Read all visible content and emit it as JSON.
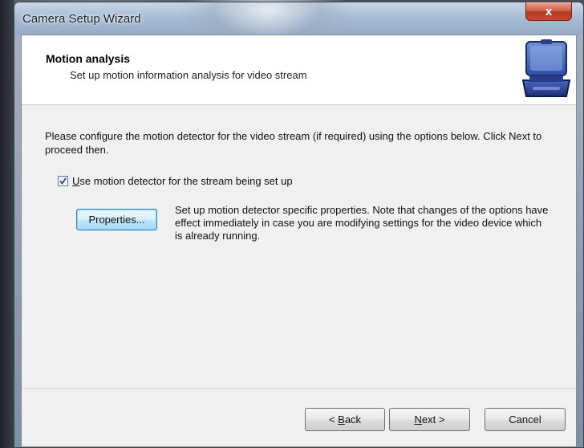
{
  "window": {
    "title": "Camera Setup Wizard",
    "close_label": "x"
  },
  "header": {
    "title": "Motion analysis",
    "subtitle": "Set up motion information analysis for video stream",
    "icon": "camera-case-icon"
  },
  "body": {
    "instructions": "Please configure the motion detector for the video stream (if required) using the options below. Click Next to proceed then.",
    "use_motion_detector": {
      "checked": true,
      "label_mnemonic": "U",
      "label_rest": "se motion detector for the stream being set up"
    },
    "properties_button": "Properties...",
    "properties_description": "Set up motion detector specific properties. Note that changes of the options have effect immediately in case you are modifying settings for the video device which is already running."
  },
  "footer": {
    "back_prefix": "< ",
    "back_mnemonic": "B",
    "back_rest": "ack",
    "next_mnemonic": "N",
    "next_rest": "ext >",
    "cancel": "Cancel"
  },
  "colors": {
    "close_button": "#c84a2f",
    "client_background": "#f0f0f0",
    "header_background": "#ffffff"
  }
}
